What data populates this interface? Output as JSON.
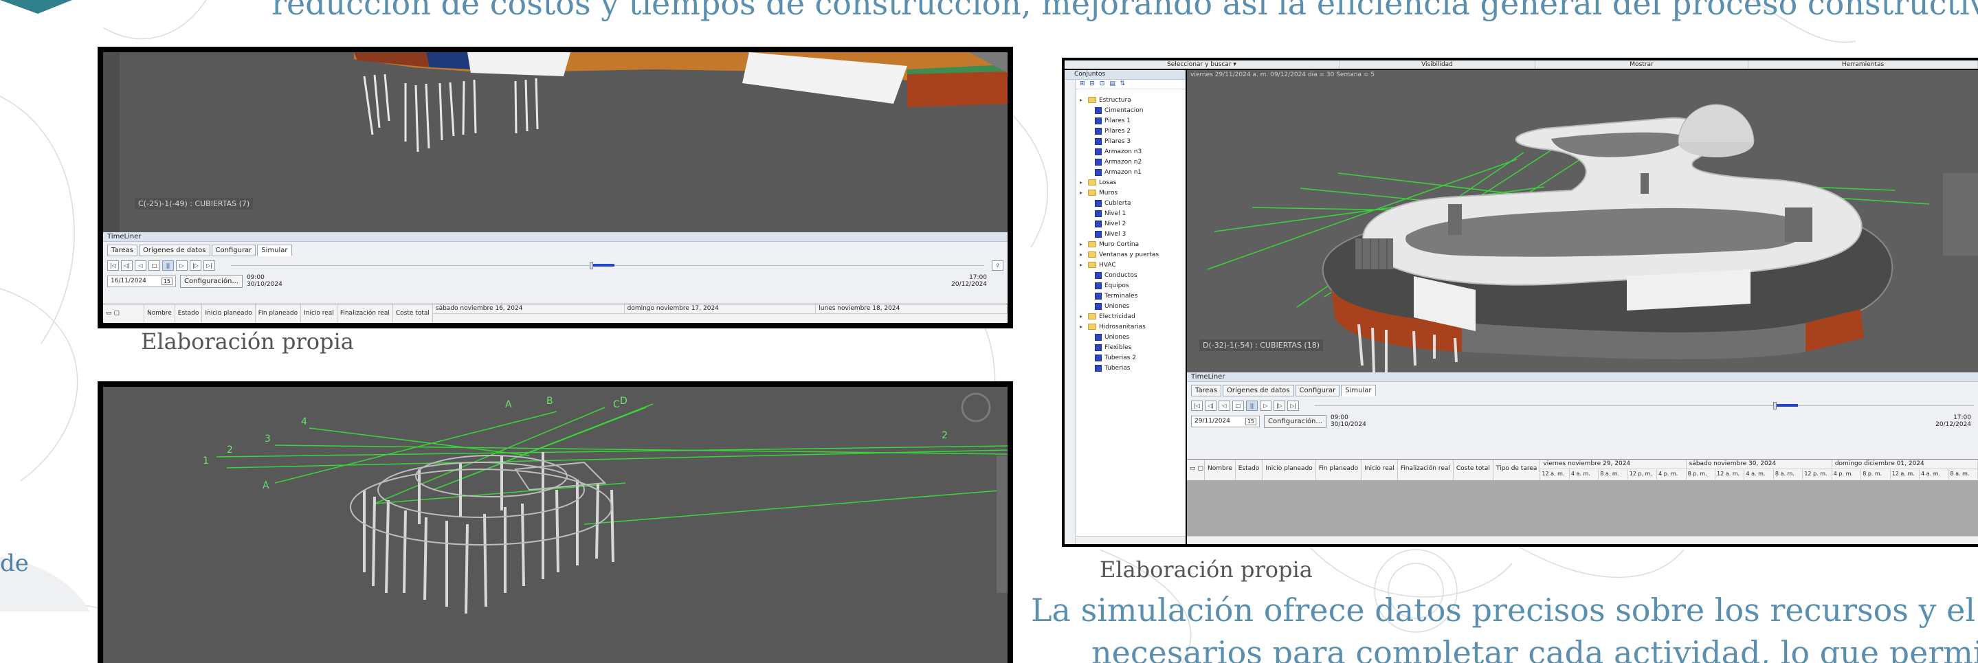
{
  "colors": {
    "caption_blue": "#5a8fb0",
    "viewport_gray": "#595959",
    "grid_gray": "#a9a9a9",
    "model_white": "#f0f0f0",
    "model_brick": "#a8421d",
    "sightline_green": "#3ad43a",
    "progress_blue": "#2346c8"
  },
  "slide": {
    "top_caption": "reducción de costos y tiempos de construcción, mejorando así la eficiencia general del proceso constructivo.",
    "left_fragment": "de",
    "caption_1": "Elaboración propia",
    "caption_2": "Elaboración propia",
    "bottom_line_1": "La simulación ofrece datos precisos sobre los recursos y el tiempo",
    "bottom_line_2": "necesarios para completar cada actividad, lo que permite"
  },
  "screenshot_1": {
    "viewport_label": "C(-25)-1(-49) : CUBIERTAS (7)",
    "timeliner": {
      "title": "TimeLiner",
      "tabs": [
        "Tareas",
        "Orígenes de datos",
        "Configurar",
        "Simular"
      ],
      "active_tab": "Simular",
      "controls": [
        "|◁",
        "◁|",
        "◁",
        "□",
        "||",
        "▷",
        "|▷",
        "▷|"
      ],
      "date_value": "16/11/2024",
      "calendar_label": "15",
      "config_button": "Configuración...",
      "start_time": "09:00",
      "start_date": "30/10/2024",
      "end_time": "17:00",
      "end_date": "20/12/2024",
      "progress": 0.48,
      "columns": [
        "Nombre",
        "Estado",
        "Inicio planeado",
        "Fin planeado",
        "Inicio real",
        "Finalización real",
        "Coste total"
      ],
      "days": [
        "sábado noviembre 16, 2024",
        "domingo noviembre 17, 2024",
        "lunes noviembre 18, 2024"
      ]
    }
  },
  "screenshot_2": {
    "label_letters": [
      "A",
      "B",
      "C",
      "D",
      "1",
      "2",
      "3",
      "4"
    ]
  },
  "screenshot_3": {
    "menu": [
      "Seleccionar y buscar ▾",
      "Visibilidad",
      "Mostrar",
      "Herramientas"
    ],
    "sets_panel": {
      "title": "Conjuntos",
      "tools": "⊞ ⊟ ⊡ ▤ ⇅",
      "tree": [
        {
          "label": "Estructura",
          "type": "folder",
          "level": 1
        },
        {
          "label": "Cimentacion",
          "type": "set",
          "level": 2
        },
        {
          "label": "Pilares 1",
          "type": "set",
          "level": 2
        },
        {
          "label": "Pilares 2",
          "type": "set",
          "level": 2
        },
        {
          "label": "Pilares 3",
          "type": "set",
          "level": 2
        },
        {
          "label": "Armazon n3",
          "type": "set",
          "level": 2
        },
        {
          "label": "Armazon n2",
          "type": "set",
          "level": 2
        },
        {
          "label": "Armazon n1",
          "type": "set",
          "level": 2
        },
        {
          "label": "Losas",
          "type": "folder",
          "level": 1
        },
        {
          "label": "Muros",
          "type": "folder",
          "level": 1
        },
        {
          "label": "Cubierta",
          "type": "set",
          "level": 2
        },
        {
          "label": "Nivel 1",
          "type": "set",
          "level": 2
        },
        {
          "label": "Nivel 2",
          "type": "set",
          "level": 2
        },
        {
          "label": "Nivel 3",
          "type": "set",
          "level": 2
        },
        {
          "label": "Muro Cortina",
          "type": "folder",
          "level": 1
        },
        {
          "label": "Ventanas y puertas",
          "type": "folder",
          "level": 1
        },
        {
          "label": "HVAC",
          "type": "folder",
          "level": 1
        },
        {
          "label": "Conductos",
          "type": "set",
          "level": 2
        },
        {
          "label": "Equipos",
          "type": "set",
          "level": 2
        },
        {
          "label": "Terminales",
          "type": "set",
          "level": 2
        },
        {
          "label": "Uniones",
          "type": "set",
          "level": 2
        },
        {
          "label": "Electricidad",
          "type": "folder",
          "level": 1
        },
        {
          "label": "Hidrosanitarias",
          "type": "folder",
          "level": 1
        },
        {
          "label": "Uniones",
          "type": "set",
          "level": 2
        },
        {
          "label": "Flexibles",
          "type": "set",
          "level": 2
        },
        {
          "label": "Tuberias 2",
          "type": "set",
          "level": 2
        },
        {
          "label": "Tuberias",
          "type": "set",
          "level": 2
        }
      ]
    },
    "viewport_label": "D(-32)-1(-54) : CUBIERTAS (18)",
    "viewport_header": "viernes 29/11/2024 a. m. 09/12/2024 día = 30 Semana = 5",
    "timeliner": {
      "title": "TimeLiner",
      "tabs": [
        "Tareas",
        "Orígenes de datos",
        "Configurar",
        "Simular"
      ],
      "active_tab": "Simular",
      "controls": [
        "|◁",
        "◁|",
        "◁",
        "□",
        "||",
        "▷",
        "|▷",
        "▷|"
      ],
      "date_value": "29/11/2024",
      "calendar_label": "15",
      "config_button": "Configuración...",
      "start_time": "09:00",
      "start_date": "30/10/2024",
      "end_time": "17:00",
      "end_date": "20/12/2024",
      "progress": 0.7,
      "columns": [
        "Nombre",
        "Estado",
        "Inicio planeado",
        "Fin planeado",
        "Inicio real",
        "Finalización real",
        "Coste total",
        "Tipo de tarea"
      ],
      "days": [
        "viernes noviembre 29, 2024",
        "sábado noviembre 30, 2024",
        "domingo diciembre 01, 2024"
      ],
      "hours": [
        "12 a. m.",
        "4 a. m.",
        "8 a. m.",
        "12 p. m.",
        "4 p. m.",
        "8 p. m.",
        "12 a. m.",
        "4 a. m.",
        "8 a. m.",
        "12 p. m.",
        "4 p. m.",
        "8 p. m.",
        "12 a. m.",
        "4 a. m.",
        "8 a. m."
      ]
    }
  }
}
